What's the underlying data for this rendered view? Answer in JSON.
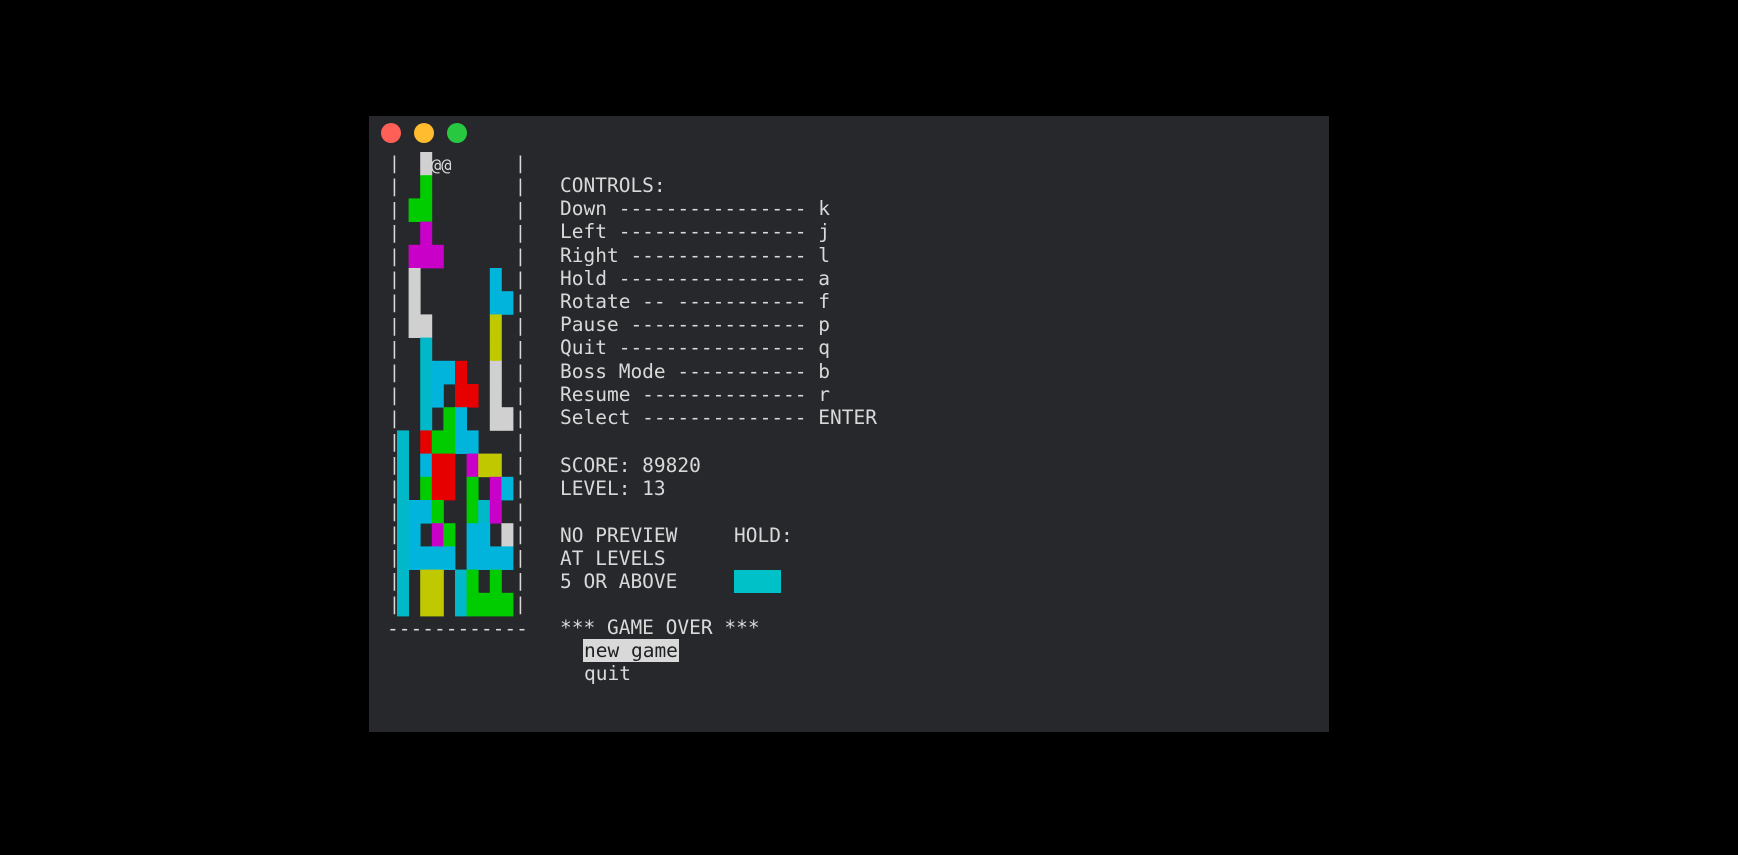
{
  "window": {
    "traffic_lights": {
      "close": "#fe5f57",
      "minimize": "#febc2e",
      "zoom": "#28c840"
    },
    "background": "#26282c",
    "text_color": "#d9d9d9"
  },
  "board": {
    "cols": 10,
    "rows": 20,
    "border_char": "|",
    "floor": "------------",
    "piece_marker": "@@",
    "palette": {
      "C": "#00b4dc",
      "T": "#00b8c8",
      "G": "#00cc00",
      "M": "#c800c8",
      "R": "#e60000",
      "Y": "#c0c800",
      "W": "#d0d0d0"
    },
    "grid": [
      "..W.......",
      "..G.......",
      ".GG.......",
      "..M.......",
      ".MMM......",
      ".W......C.",
      ".W......CC",
      ".WW.....Y.",
      "..T.....Y.",
      "..TCCR..W.",
      "..TC.RR.W.",
      "..T.GC..WW",
      "T.RGGCC...",
      "T.CRR.MYY.",
      "T.GRR.G.MC",
      "TCCG..GTM.",
      "TC.MG.CC.W",
      "TCCCC.CCCC",
      "T.YY.TG.G.",
      "T.YY.TGGGG"
    ]
  },
  "controls": {
    "title": "CONTROLS:",
    "rows": [
      "Down ---------------- k",
      "Left ---------------- j",
      "Right --------------- l",
      "Hold ---------------- a",
      "Rotate -- ----------- f",
      "Pause --------------- p",
      "Quit ---------------- q",
      "Boss Mode ----------- b",
      "Resume -------------- r",
      "Select -------------- ENTER"
    ]
  },
  "stats": {
    "score_label": "SCORE: 89820",
    "level_label": "LEVEL: 13"
  },
  "preview": {
    "line1": "NO PREVIEW",
    "line2": "AT LEVELS",
    "line3": "5 OR ABOVE"
  },
  "hold": {
    "label": "HOLD:",
    "piece_color": "#00c0c8"
  },
  "game_over": {
    "banner": "*** GAME OVER ***",
    "menu": [
      {
        "label": "new game",
        "selected": true
      },
      {
        "label": "quit",
        "selected": false
      }
    ]
  }
}
